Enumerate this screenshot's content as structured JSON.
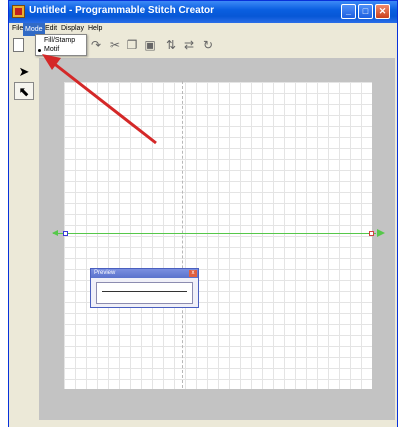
{
  "window": {
    "title": "Untitled - Programmable Stitch Creator",
    "controls": [
      "_",
      "□",
      "✕"
    ]
  },
  "menubar": {
    "items": [
      "File",
      "Mode",
      "Edit",
      "Display",
      "Help"
    ]
  },
  "mode_menu": {
    "items": [
      "Fill/Stamp",
      "Motif"
    ],
    "selected": "Motif"
  },
  "toolbar": {
    "icons": [
      "new-file-icon",
      "redo-icon",
      "cut-icon",
      "copy-icon",
      "paste-icon",
      "flip-icon",
      "mirror-icon",
      "rotate-icon"
    ]
  },
  "sidebar": {
    "tools": [
      "select-arrow-icon",
      "point-edit-icon"
    ]
  },
  "preview": {
    "title": "Preview",
    "close_label": "x"
  },
  "colors": {
    "guide_line": "#56c84a",
    "annotation_arrow": "#d42828",
    "titlebar": "#0a5fe0",
    "menu_highlight": "#316ac5"
  }
}
